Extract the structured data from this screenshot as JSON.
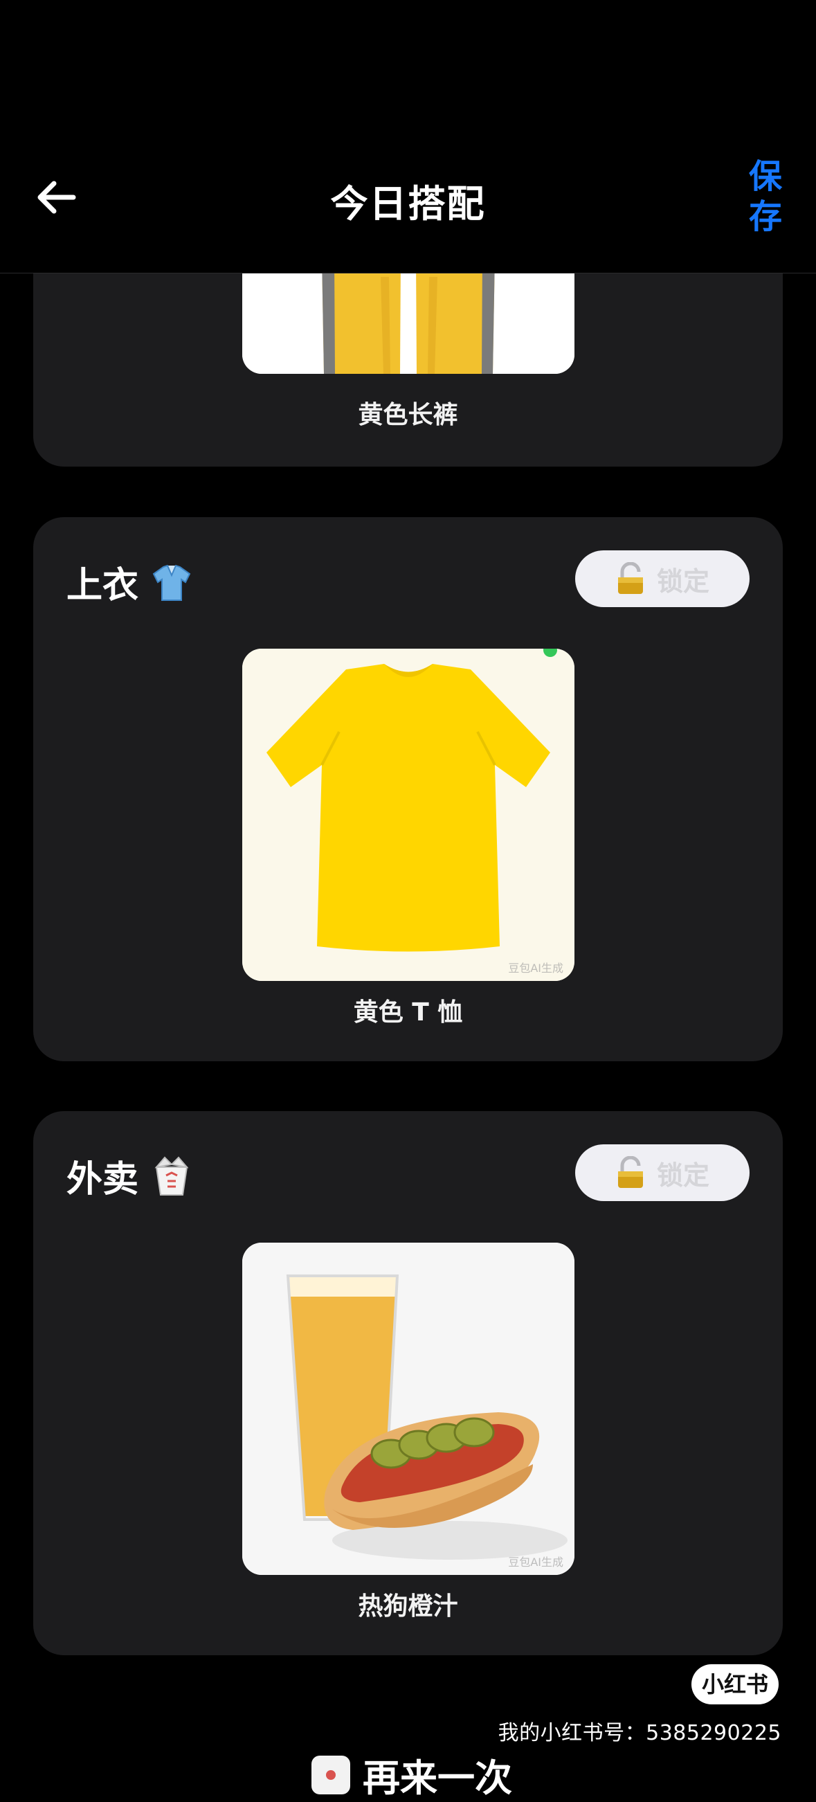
{
  "header": {
    "title": "今日搭配",
    "save_label": "保存"
  },
  "sections": [
    {
      "item_label": "黄色长裤"
    },
    {
      "title": "上衣",
      "icon": "polo-shirt-icon",
      "lock_label": "锁定",
      "item_label": "黄色 T 恤",
      "watermark": "豆包AI生成"
    },
    {
      "title": "外卖",
      "icon": "takeout-box-icon",
      "lock_label": "锁定",
      "item_label": "热狗橙汁",
      "watermark": "豆包AI生成"
    }
  ],
  "footer": {
    "brand": "小红书",
    "account": "我的小红书号：5385290225",
    "reroll_label": "再来一次"
  },
  "colors": {
    "accent": "#1677ff",
    "card_bg": "#1c1c1e",
    "lock_bg": "#efeff4",
    "pants_yellow": "#f2c12e",
    "shirt_yellow": "#ffd600"
  }
}
